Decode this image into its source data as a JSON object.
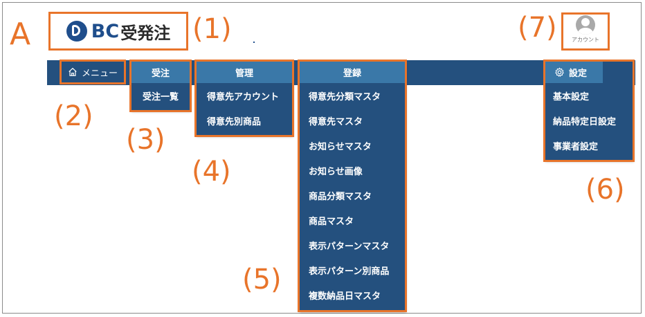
{
  "annotations": {
    "letter": "A",
    "n1": "(1)",
    "n2": "(2)",
    "n3": "(3)",
    "n4": "(4)",
    "n5": "(5)",
    "n6": "(6)",
    "n7": "(7)"
  },
  "logo": {
    "mark_text": "BC",
    "text": "受発注"
  },
  "account": {
    "label": "アカウント",
    "icon": "user-icon"
  },
  "nav": {
    "menu": {
      "label": "メニュー",
      "icon": "home-icon"
    },
    "juchu": {
      "header": "受注",
      "items": [
        "受注一覧"
      ]
    },
    "kanri": {
      "header": "管理",
      "items": [
        "得意先アカウント",
        "得意先別商品"
      ]
    },
    "touroku": {
      "header": "登録",
      "items": [
        "得意先分類マスタ",
        "得意先マスタ",
        "お知らせマスタ",
        "お知らせ画像",
        "商品分類マスタ",
        "商品マスタ",
        "表示パターンマスタ",
        "表示パターン別商品",
        "複数納品日マスタ"
      ]
    },
    "settei": {
      "header": "設定",
      "icon": "gear-icon",
      "items": [
        "基本設定",
        "納品特定日設定",
        "事業者設定"
      ]
    }
  },
  "colors": {
    "navbar": "#24507e",
    "dropdown_header": "#3a78a8",
    "annotation": "#e8742a",
    "brand": "#1f4e8c"
  }
}
